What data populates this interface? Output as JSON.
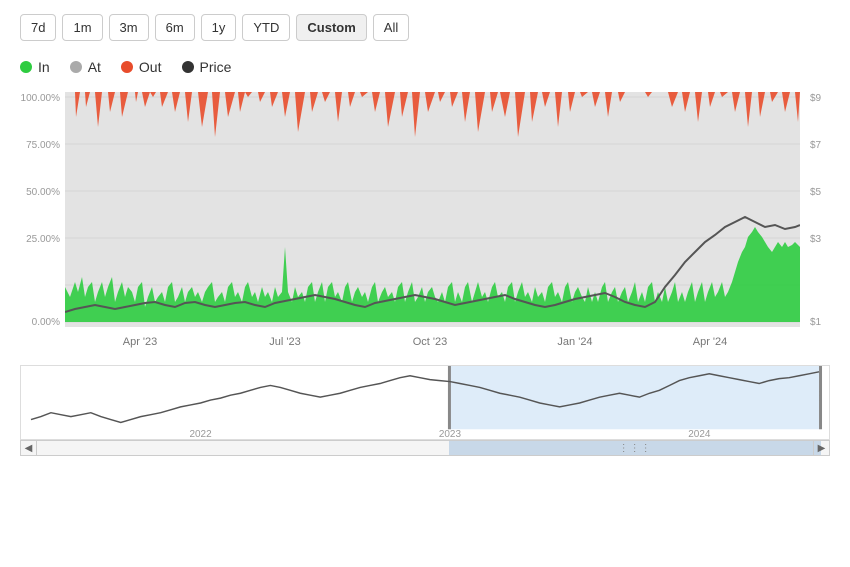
{
  "timeButtons": [
    {
      "label": "7d",
      "active": false
    },
    {
      "label": "1m",
      "active": false
    },
    {
      "label": "3m",
      "active": false
    },
    {
      "label": "6m",
      "active": false
    },
    {
      "label": "1y",
      "active": false
    },
    {
      "label": "YTD",
      "active": false
    },
    {
      "label": "Custom",
      "active": true
    },
    {
      "label": "All",
      "active": false
    }
  ],
  "legend": [
    {
      "label": "In",
      "color": "#2ecc40"
    },
    {
      "label": "At",
      "color": "#aaa"
    },
    {
      "label": "Out",
      "color": "#e84c2b"
    },
    {
      "label": "Price",
      "color": "#333"
    }
  ],
  "yAxisLeft": [
    "100.00%",
    "75.00%",
    "50.00%",
    "25.00%",
    "0.00%"
  ],
  "yAxisRight": [
    "$9",
    "$7",
    "$5",
    "$3",
    "$1"
  ],
  "xAxisLabels": [
    "Apr '23",
    "Jul '23",
    "Oct '23",
    "Jan '24",
    "Apr '24"
  ],
  "miniXLabels": [
    "2022",
    "2023",
    "2024"
  ],
  "colors": {
    "in": "#2ecc40",
    "at": "#c8c8c8",
    "out": "#e84c2b",
    "price": "#555",
    "selection": "#d0e4f7"
  }
}
